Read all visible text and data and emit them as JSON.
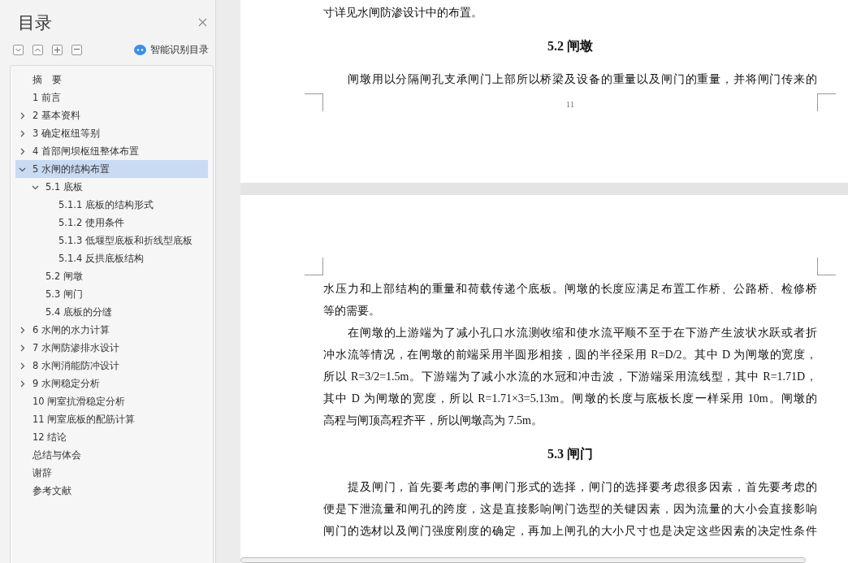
{
  "sidebar": {
    "title": "目录",
    "smart_toc": "智能识别目录",
    "toc": [
      {
        "label": "摘　要",
        "selected": false
      },
      {
        "label": "1 前言",
        "selected": false
      },
      {
        "label": "2 基本资料",
        "selected": false,
        "expanded": false
      },
      {
        "label": "3  确定枢纽等别",
        "selected": false,
        "expanded": false
      },
      {
        "label": "4 首部闸坝枢纽整体布置",
        "selected": false,
        "expanded": false
      },
      {
        "label": "5 水闸的结构布置",
        "selected": true,
        "expanded": true,
        "children": [
          {
            "label": "5.1 底板",
            "selected": false,
            "expanded": true,
            "children": [
              {
                "label": "5.1.1 底板的结构形式",
                "selected": false
              },
              {
                "label": "5.1.2 使用条件",
                "selected": false
              },
              {
                "label": "5.1.3 低堰型底板和折线型底板",
                "selected": false
              },
              {
                "label": "5.1.4 反拱底板结构",
                "selected": false
              }
            ]
          },
          {
            "label": "5.2 闸墩",
            "selected": false
          },
          {
            "label": "5.3 闸门",
            "selected": false
          },
          {
            "label": "5.4 底板的分缝",
            "selected": false
          }
        ]
      },
      {
        "label": "6 水闸的水力计算",
        "selected": false,
        "expanded": false
      },
      {
        "label": "7 水闸防渗排水设计",
        "selected": false,
        "expanded": false
      },
      {
        "label": "8 水闸消能防冲设计",
        "selected": false,
        "expanded": false
      },
      {
        "label": "9 水闸稳定分析",
        "selected": false,
        "expanded": false
      },
      {
        "label": "10 闸室抗滑稳定分析",
        "selected": false
      },
      {
        "label": "11 闸室底板的配筋计算",
        "selected": false
      },
      {
        "label": "12 结论",
        "selected": false
      },
      {
        "label": "总结与体会",
        "selected": false
      },
      {
        "label": "谢辞",
        "selected": false
      },
      {
        "label": "参考文献",
        "selected": false
      }
    ]
  },
  "pages": [
    {
      "page_number": "11",
      "blocks": [
        {
          "kind": "paragraph",
          "indent": false,
          "lines": [
            "寸详见水闸防渗设计中的布置。"
          ]
        },
        {
          "kind": "heading",
          "text": "5.2 闸墩"
        },
        {
          "kind": "paragraph",
          "indent": true,
          "continues": true,
          "lines": [
            "闸墩用以分隔闸孔支承闸门上部所以桥梁及设备的重量以及闸门的重量，并将闸门传来的"
          ]
        }
      ]
    },
    {
      "blocks": [
        {
          "kind": "paragraph",
          "indent": false,
          "lines": [
            "水压力和上部结构的重量和荷载传递个底板。闸墩的长度应满足布置工作桥、公路桥、检修桥",
            "等的需要。"
          ]
        },
        {
          "kind": "paragraph",
          "indent": true,
          "lines": [
            "在闸墩的上游端为了减小孔口水流测收缩和使水流平顺不至于在下游产生波状水跃或者折",
            "冲水流等情况，在闸墩的前端采用半圆形相接，圆的半径采用 R=D/2。其中 D 为闸墩的宽度，",
            "所以 R=3/2=1.5m。下游端为了减小水流的水冠和冲击波，下游端采用流线型，其中 R=1.71D，",
            "其中 D 为闸墩的宽度，所以 R=1.71×3=5.13m。闸墩的长度与底板长度一样采用 10m。闸墩的",
            "高程与闸顶高程齐平，所以闸墩高为 7.5m。"
          ]
        },
        {
          "kind": "heading",
          "text": "5.3 闸门"
        },
        {
          "kind": "paragraph",
          "indent": true,
          "continues": true,
          "lines": [
            "提及闸门，首先要考虑的事闸门形式的选择，闸门的选择要考虑很多因素，首先要考虑的",
            "便是下泄流量和闸孔的跨度，这是直接影响闸门选型的关键因素，因为流量的大小会直接影响",
            "闸门的选材以及闸门强度刚度的确定，再加上闸孔的大小尺寸也是决定这些因素的决定性条件"
          ]
        }
      ]
    }
  ]
}
